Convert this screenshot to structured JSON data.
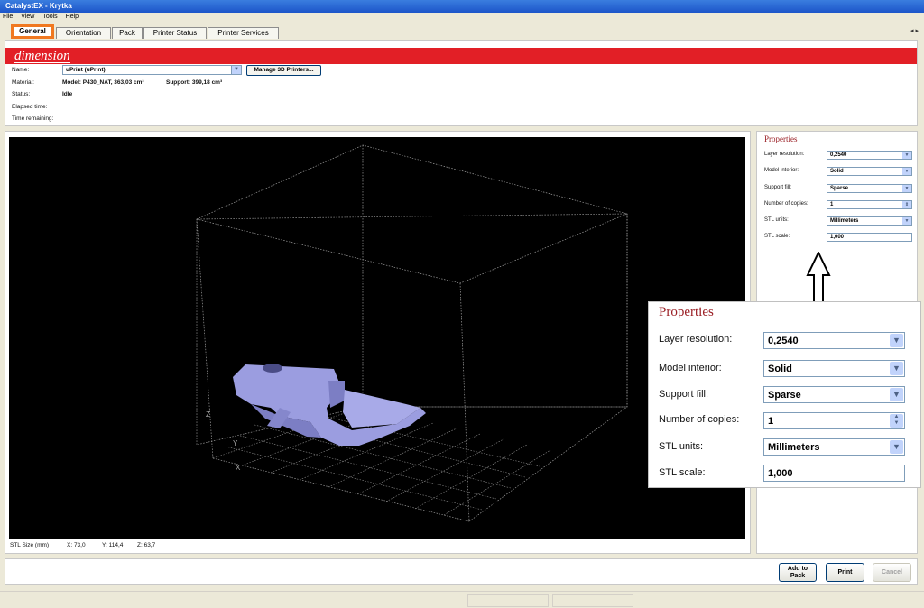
{
  "window": {
    "title": "CatalystEX - Krytka"
  },
  "menu": [
    "File",
    "View",
    "Tools",
    "Help"
  ],
  "tabs": [
    {
      "label": "General",
      "active": true
    },
    {
      "label": "Orientation",
      "active": false
    },
    {
      "label": "Pack",
      "active": false
    },
    {
      "label": "Printer Status",
      "active": false
    },
    {
      "label": "Printer Services",
      "active": false
    }
  ],
  "tab_scroll": "◂ ▸",
  "brand": {
    "name": "dimension",
    "color": "#e21f26"
  },
  "printer_info": {
    "name_label": "Name:",
    "name_value": "uPrint (uPrint)",
    "manage_button": "Manage 3D Printers...",
    "material_label": "Material:",
    "model_value": "Model: P430_NAT, 363,03 cm³",
    "support_value": "Support: 399,18 cm³",
    "status_label": "Status:",
    "status_value": "Idle",
    "elapsed_label": "Elapsed time:",
    "remaining_label": "Time remaining:"
  },
  "viewport": {
    "axis_z": "Z",
    "axis_y": "Y",
    "axis_x": "X",
    "model_color": "#9b9de0",
    "stl_size": {
      "label": "STL Size (mm)",
      "x": "X:  73,0",
      "y": "Y:  114,4",
      "z": "Z:  63,7"
    }
  },
  "properties": {
    "title": "Properties",
    "layer_resolution": {
      "label": "Layer resolution:",
      "value": "0,2540"
    },
    "model_interior": {
      "label": "Model interior:",
      "value": "Solid"
    },
    "support_fill": {
      "label": "Support fill:",
      "value": "Sparse"
    },
    "copies": {
      "label": "Number of copies:",
      "value": "1"
    },
    "stl_units": {
      "label": "STL units:",
      "value": "Millimeters"
    },
    "stl_scale": {
      "label": "STL scale:",
      "value": "1,000"
    }
  },
  "buttons": {
    "add_to_pack": "Add to\nPack",
    "add_to_pack_line1": "Add to",
    "add_to_pack_line2": "Pack",
    "print": "Print",
    "cancel": "Cancel"
  },
  "colors": {
    "accent": "#f07820",
    "title_red": "#9a1e24",
    "titlebar": "#2a63d4"
  }
}
